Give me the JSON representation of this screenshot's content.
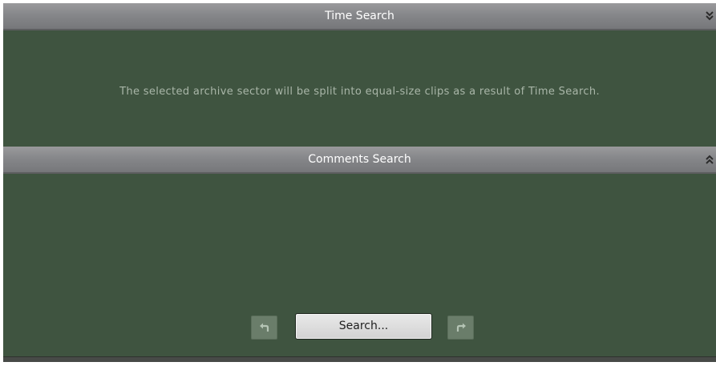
{
  "time_search": {
    "title": "Time Search",
    "description": "The selected archive sector will be split into equal-size clips as a result of Time Search.",
    "chevron_icon": "double-chevron-down-icon"
  },
  "comments_search": {
    "title": "Comments Search",
    "chevron_icon": "double-chevron-up-icon"
  },
  "controls": {
    "search_label": "Search...",
    "back_icon": "undo-arrow-icon",
    "forward_icon": "redo-arrow-icon"
  },
  "colors": {
    "panel_bg": "#3f5440",
    "header_bar": "#86878a",
    "nav_button": "#6a7d6a",
    "search_button": "#d9d9d9"
  }
}
